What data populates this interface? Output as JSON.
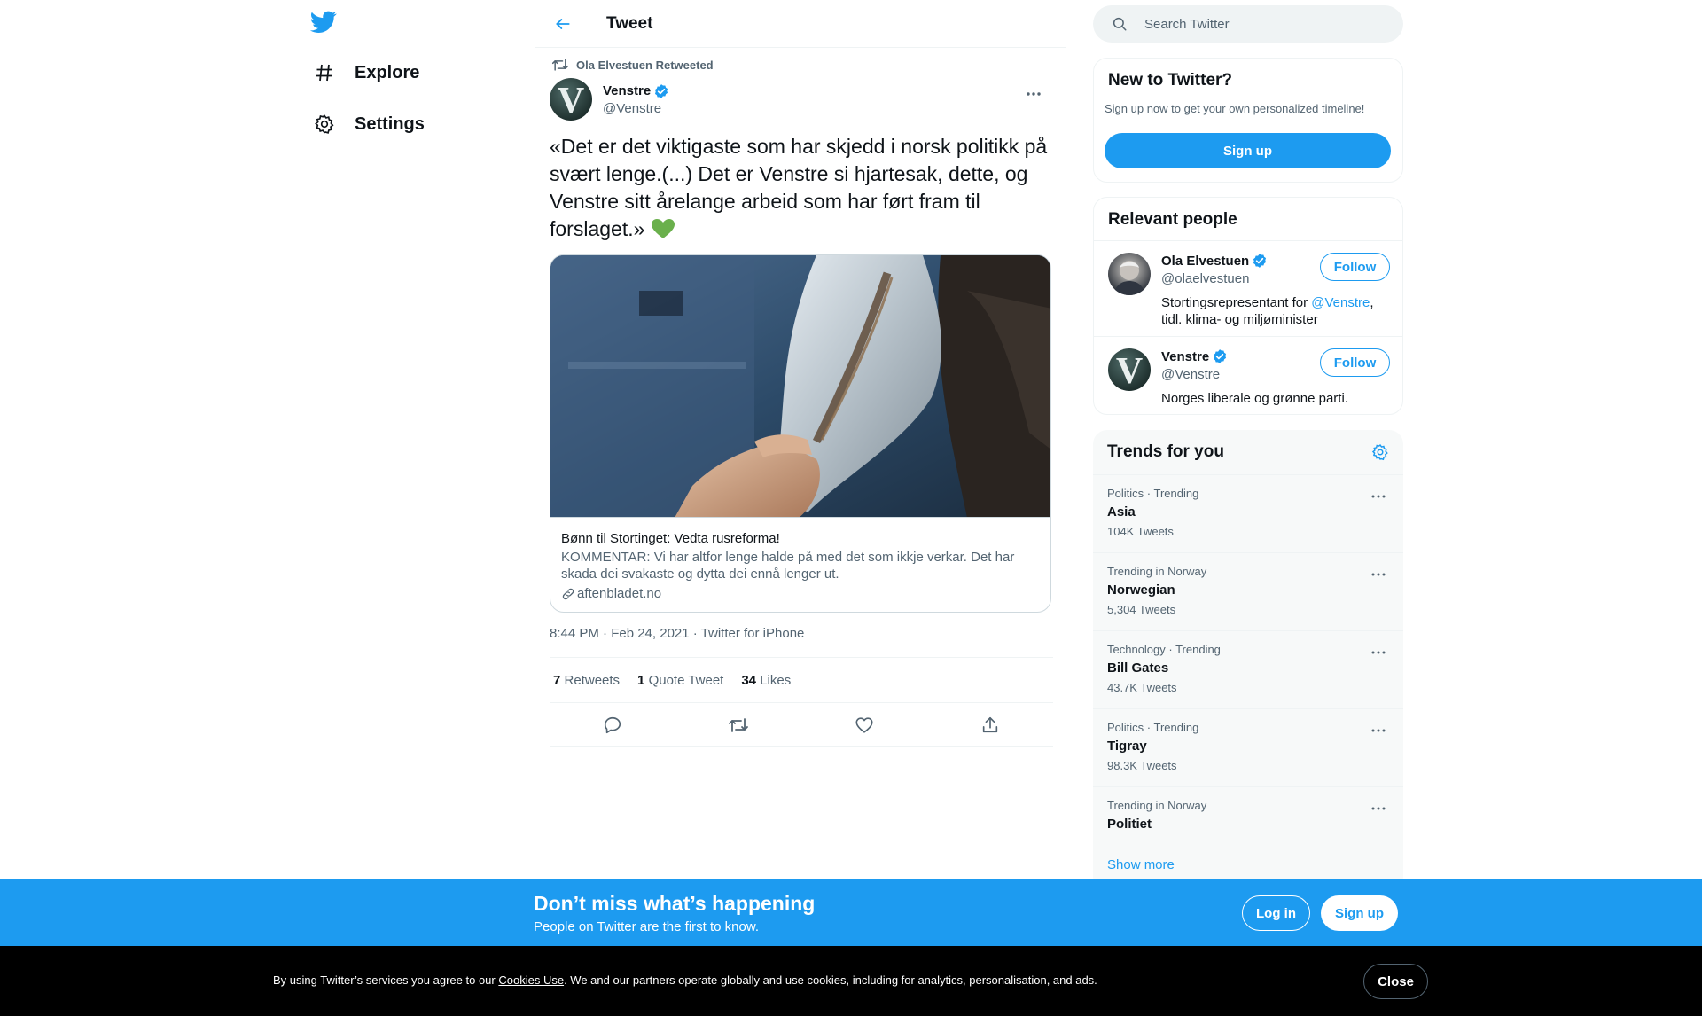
{
  "colors": {
    "accent": "#1d9bf0",
    "text": "#0f1419",
    "secondary": "#536471",
    "border": "#eff3f4",
    "heart_emoji": "#6ab04c"
  },
  "nav": {
    "items": [
      {
        "label": "Explore",
        "icon": "hashtag-icon"
      },
      {
        "label": "Settings",
        "icon": "gear-icon"
      }
    ]
  },
  "header": {
    "title": "Tweet"
  },
  "tweet": {
    "retweeted_by": "Ola Elvestuen Retweeted",
    "author_name": "Venstre",
    "author_handle": "@Venstre",
    "avatar_letter": "V",
    "text": "«Det er det viktigaste som har skjedd i norsk politikk på svært lenge.(...) Det er Venstre si hjartesak, dette, og Venstre sitt årelange arbeid som har ført fram til forslaget.»",
    "emoji": "green-heart",
    "card": {
      "title": "Bønn til Stortinget: Vedta rusreforma!",
      "description": "KOMMENTAR: Vi har altfor lenge halde på med det som ikkje verkar. Det har skada dei svakaste og dytta dei ennå lenger ut.",
      "domain": "aftenbladet.no"
    },
    "meta": "8:44 PM · Feb 24, 2021 · Twitter for iPhone",
    "stats": [
      {
        "count": "7",
        "label": "Retweets"
      },
      {
        "count": "1",
        "label": "Quote Tweet"
      },
      {
        "count": "34",
        "label": "Likes"
      }
    ]
  },
  "search": {
    "placeholder": "Search Twitter"
  },
  "new_to_twitter": {
    "title": "New to Twitter?",
    "subtitle": "Sign up now to get your own personalized timeline!",
    "button": "Sign up"
  },
  "relevant_people": {
    "title": "Relevant people",
    "people": [
      {
        "name": "Ola Elvestuen",
        "handle": "@olaelvestuen",
        "bio_prefix": "Stortingsrepresentant for ",
        "bio_mention": "@Venstre",
        "bio_suffix": ", tidl. klima- og miljøminister",
        "follow": "Follow"
      },
      {
        "name": "Venstre",
        "handle": "@Venstre",
        "bio": "Norges liberale og grønne parti.",
        "follow": "Follow",
        "avatar_letter": "V"
      }
    ]
  },
  "trends": {
    "title": "Trends for you",
    "items": [
      {
        "context": "Politics · Trending",
        "name": "Asia",
        "count": "104K Tweets"
      },
      {
        "context": "Trending in Norway",
        "name": "Norwegian",
        "count": "5,304 Tweets"
      },
      {
        "context": "Technology · Trending",
        "name": "Bill Gates",
        "count": "43.7K Tweets"
      },
      {
        "context": "Politics · Trending",
        "name": "Tigray",
        "count": "98.3K Tweets"
      },
      {
        "context": "Trending in Norway",
        "name": "Politiet",
        "count": ""
      }
    ],
    "show_more": "Show more"
  },
  "banner": {
    "heading": "Don’t miss what’s happening",
    "subheading": "People on Twitter are the first to know.",
    "login": "Log in",
    "signup": "Sign up"
  },
  "cookie": {
    "prefix": "By using Twitter’s services you agree to our ",
    "link": "Cookies Use",
    "suffix": ". We and our partners operate globally and use cookies, including for analytics, personalisation, and ads.",
    "close": "Close"
  }
}
